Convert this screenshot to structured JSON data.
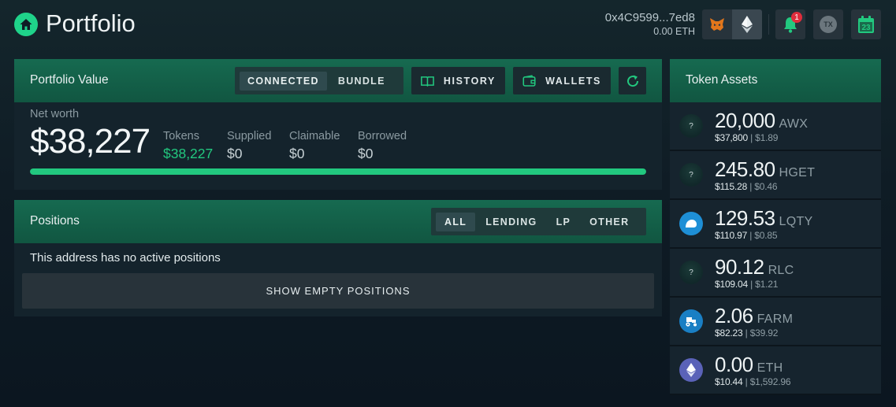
{
  "header": {
    "title": "Portfolio",
    "account_address": "0x4C9599...7ed8",
    "account_balance": "0.00 ETH",
    "notification_count": "1",
    "tx_label": "TX",
    "calendar_day": "23"
  },
  "portfolio_value": {
    "title": "Portfolio Value",
    "view_toggle": [
      "CONNECTED",
      "BUNDLE"
    ],
    "view_selected": "CONNECTED",
    "history_label": "HISTORY",
    "wallets_label": "WALLETS",
    "net_worth_label": "Net worth",
    "net_worth": "$38,227",
    "stats": [
      {
        "label": "Tokens",
        "value": "$38,227"
      },
      {
        "label": "Supplied",
        "value": "$0"
      },
      {
        "label": "Claimable",
        "value": "$0"
      },
      {
        "label": "Borrowed",
        "value": "$0"
      }
    ],
    "progress_fraction": 1.0
  },
  "positions": {
    "title": "Positions",
    "filters": [
      "ALL",
      "LENDING",
      "LP",
      "OTHER"
    ],
    "filter_selected": "ALL",
    "empty_message": "This address has no active positions",
    "show_empty_label": "SHOW EMPTY POSITIONS"
  },
  "token_assets": {
    "title": "Token Assets",
    "tokens": [
      {
        "amount": "20,000",
        "symbol": "AWX",
        "value": "$37,800",
        "price": "$1.89",
        "icon": "unknown-token-icon",
        "icon_text": "?"
      },
      {
        "amount": "245.80",
        "symbol": "HGET",
        "value": "$115.28",
        "price": "$0.46",
        "icon": "unknown-token-icon",
        "icon_text": "?"
      },
      {
        "amount": "129.53",
        "symbol": "LQTY",
        "value": "$110.97",
        "price": "$0.85",
        "icon": "liquity-icon",
        "icon_text": ""
      },
      {
        "amount": "90.12",
        "symbol": "RLC",
        "value": "$109.04",
        "price": "$1.21",
        "icon": "unknown-token-icon",
        "icon_text": "?"
      },
      {
        "amount": "2.06",
        "symbol": "FARM",
        "value": "$82.23",
        "price": "$39.92",
        "icon": "tractor-icon",
        "icon_text": ""
      },
      {
        "amount": "0.00",
        "symbol": "ETH",
        "value": "$10.44",
        "price": "$1,592.96",
        "icon": "ethereum-icon",
        "icon_text": ""
      }
    ]
  },
  "colors": {
    "accent_green": "#22c87f",
    "header_green": "#13604a",
    "notification_red": "#e02d3c"
  }
}
